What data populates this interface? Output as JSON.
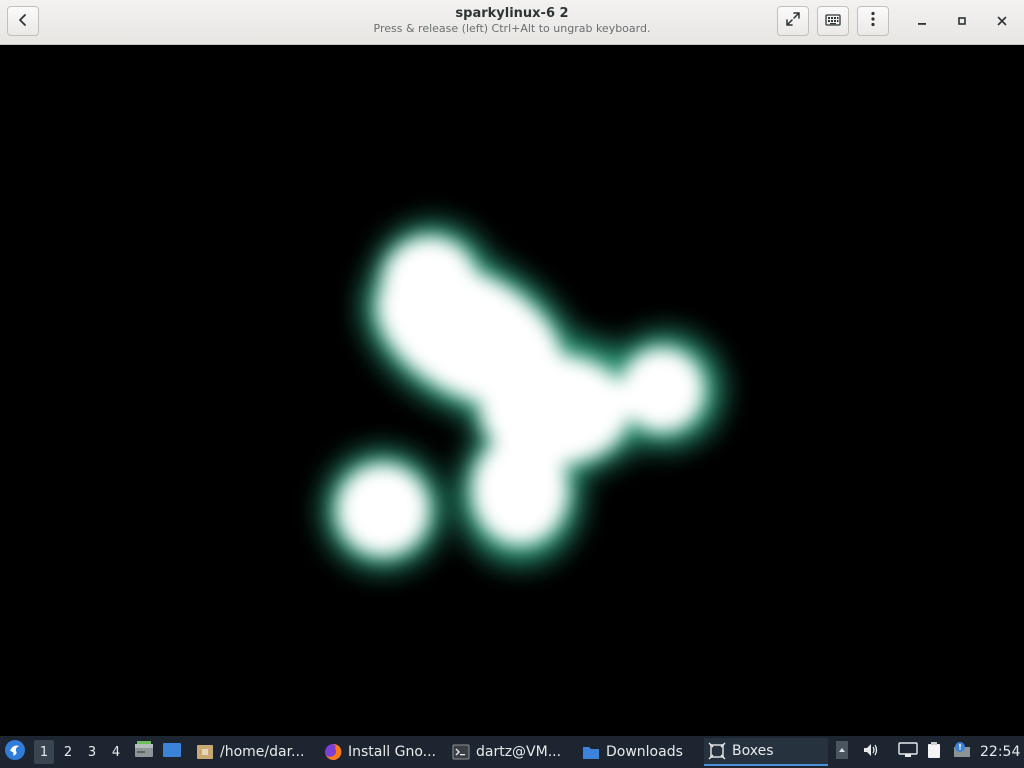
{
  "window": {
    "title": "sparkylinux-6 2",
    "subtitle": "Press & release (left) Ctrl+Alt to ungrab keyboard."
  },
  "header_buttons": {
    "back_icon": "chevron-left-icon",
    "fullscreen_icon": "fullscreen-icon",
    "keyboard_icon": "keyboard-icon",
    "menu_icon": "kebab-menu-icon",
    "minimize_icon": "minimize-icon",
    "maximize_icon": "maximize-icon",
    "close_icon": "close-icon"
  },
  "vm_display": {
    "background": "#000000",
    "blob_glow_color": "#2a9d7a",
    "blob_core_color": "#ffffff"
  },
  "taskbar": {
    "workspaces": [
      "1",
      "2",
      "3",
      "4"
    ],
    "active_workspace": "1",
    "tasks": [
      {
        "label": "/home/dar...",
        "icon": "folder-home-icon"
      },
      {
        "label": "Install Gno...",
        "icon": "firefox-icon"
      },
      {
        "label": "dartz@VM...",
        "icon": "terminal-icon"
      },
      {
        "label": "Downloads",
        "icon": "folder-icon"
      },
      {
        "label": "Boxes",
        "icon": "boxes-icon"
      }
    ],
    "active_task": "Boxes",
    "clock": "22:54",
    "accent_color": "#4a90d9"
  }
}
